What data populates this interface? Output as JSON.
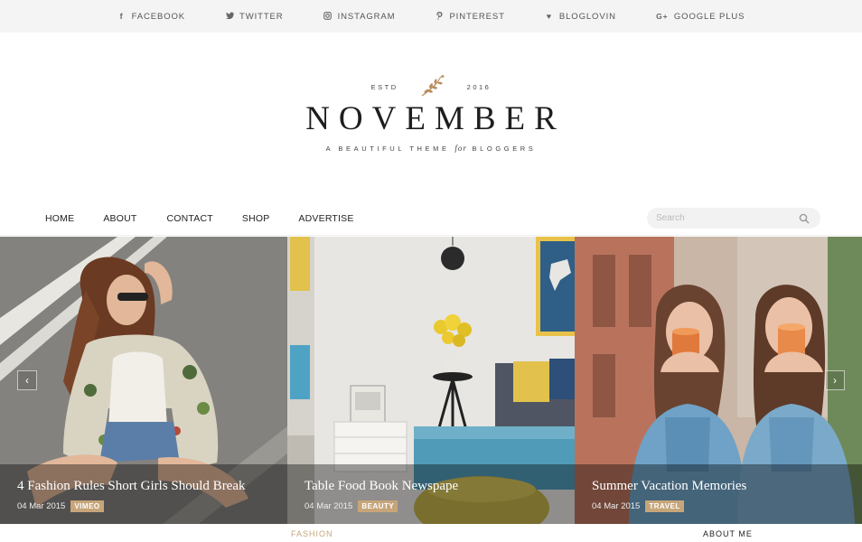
{
  "social": [
    {
      "icon": "facebook-icon",
      "glyph": "f",
      "label": "FACEBOOK"
    },
    {
      "icon": "twitter-icon",
      "glyph": "🐦",
      "label": "TWITTER"
    },
    {
      "icon": "instagram-icon",
      "glyph": "◎",
      "label": "INSTAGRAM"
    },
    {
      "icon": "pinterest-icon",
      "glyph": "℗",
      "label": "PINTEREST"
    },
    {
      "icon": "heart-icon",
      "glyph": "♥",
      "label": "BLOGLOVIN"
    },
    {
      "icon": "google-plus-icon",
      "glyph": "G+",
      "label": "GOOGLE PLUS"
    }
  ],
  "logo": {
    "estd": "ESTD",
    "year": "2016",
    "title": "NOVEMBER",
    "tagline_pre": "A BEAUTIFUL THEME",
    "tagline_for": "for",
    "tagline_post": "BLOGGERS"
  },
  "nav": {
    "items": [
      "HOME",
      "ABOUT",
      "CONTACT",
      "SHOP",
      "ADVERTISE"
    ],
    "search_placeholder": "Search"
  },
  "slides": [
    {
      "title": "4 Fashion Rules Short Girls Should Break",
      "date": "04 Mar 2015",
      "category": "VIMEO"
    },
    {
      "title": "Table Food Book Newspape",
      "date": "04 Mar 2015",
      "category": "BEAUTY"
    },
    {
      "title": "Summer Vacation Memories",
      "date": "04 Mar 2015",
      "category": "TRAVEL"
    }
  ],
  "slider_controls": {
    "prev": "‹",
    "next": "›"
  },
  "bottom": {
    "left": "FASHION",
    "right": "ABOUT ME"
  },
  "colors": {
    "accent": "#c7a57a",
    "topbar": "#f4f4f4"
  }
}
